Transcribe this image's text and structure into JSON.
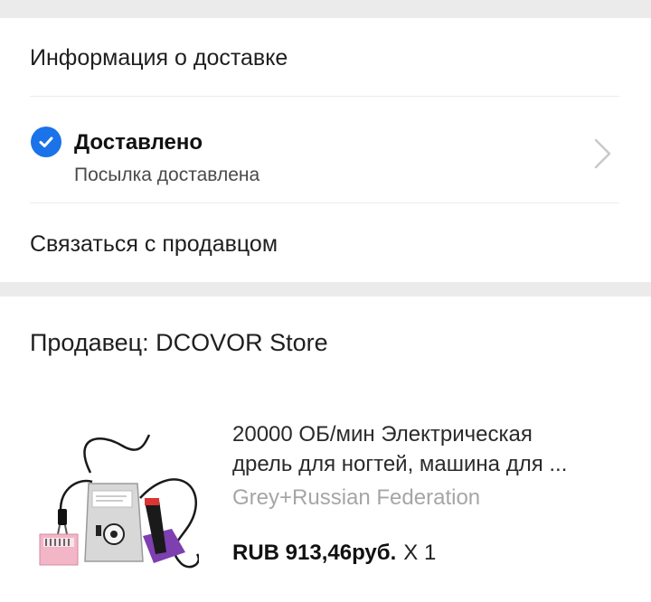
{
  "delivery": {
    "heading": "Информация о доставке",
    "status_title": "Доставлено",
    "status_subtitle": "Посылка доставлена",
    "contact_seller": "Связаться с продавцом",
    "status_icon": "check-circle-icon",
    "accent_color": "#1a73e8"
  },
  "seller": {
    "heading": "Продавец: DCOVOR Store",
    "product": {
      "name_line1": "20000 ОБ/мин Электрическая",
      "name_line2": "дрель для ногтей, машина для ...",
      "variant": "Grey+Russian Federation",
      "price": "RUB 913,46руб.",
      "quantity": "X 1"
    }
  }
}
